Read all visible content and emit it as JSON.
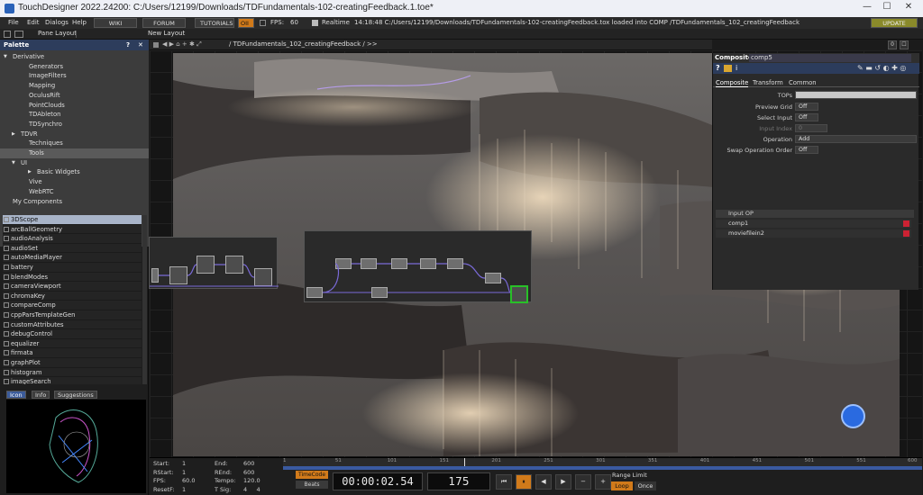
{
  "window": {
    "title": "TouchDesigner 2022.24200: C:/Users/12199/Downloads/TDFundamentals-102-creatingFeedback.1.toe*",
    "controls": [
      "—",
      "☐",
      "✕"
    ]
  },
  "menubar": {
    "items": [
      "File",
      "Edit",
      "Dialogs",
      "Help"
    ],
    "buttons": [
      "WIKI",
      "FORUM",
      "TUTORIALS"
    ],
    "oii": "OII",
    "fps_label": "FPS:",
    "fps_value": "60",
    "realtime": "Realtime",
    "status": "14:18:48 C:/Users/12199/Downloads/TDFundamentals-102-creatingFeedback.tox loaded into COMP /TDFundamentals_102_creatingFeedback",
    "update": "UPDATE"
  },
  "toolbar2": {
    "pane_layout": "Pane Layout",
    "new_layout": "New Layout"
  },
  "palette": {
    "title": "Palette",
    "header_buttons": [
      "?",
      "✕"
    ],
    "categories": [
      {
        "label": "Derivative",
        "indent": 0,
        "arrow": "▼"
      },
      {
        "label": "Generators",
        "indent": 2,
        "arrow": ""
      },
      {
        "label": "ImageFilters",
        "indent": 2,
        "arrow": ""
      },
      {
        "label": "Mapping",
        "indent": 2,
        "arrow": ""
      },
      {
        "label": "OculusRift",
        "indent": 2,
        "arrow": ""
      },
      {
        "label": "PointClouds",
        "indent": 2,
        "arrow": ""
      },
      {
        "label": "TDAbleton",
        "indent": 2,
        "arrow": ""
      },
      {
        "label": "TDSynchro",
        "indent": 2,
        "arrow": ""
      },
      {
        "label": "TDVR",
        "indent": 1,
        "arrow": "▶"
      },
      {
        "label": "Techniques",
        "indent": 2,
        "arrow": ""
      },
      {
        "label": "Tools",
        "indent": 2,
        "arrow": "",
        "selected": true
      },
      {
        "label": "UI",
        "indent": 1,
        "arrow": "▼"
      },
      {
        "label": "Basic Widgets",
        "indent": 3,
        "arrow": "▶"
      },
      {
        "label": "Vive",
        "indent": 2,
        "arrow": ""
      },
      {
        "label": "WebRTC",
        "indent": 2,
        "arrow": ""
      },
      {
        "label": "My Components",
        "indent": 0,
        "arrow": ""
      }
    ],
    "components": [
      "3DScope",
      "arcBallGeometry",
      "audioAnalysis",
      "audioSet",
      "autoMediaPlayer",
      "battery",
      "blendModes",
      "cameraViewport",
      "chromaKey",
      "compareComp",
      "cppParsTemplateGen",
      "customAttributes",
      "debugControl",
      "equalizer",
      "firmata",
      "graphPlot",
      "histogram",
      "imageSearch"
    ],
    "tabs": [
      "Icon",
      "Info",
      "Suggestions"
    ]
  },
  "network": {
    "path": "/ TDFundamentals_102_creatingFeedback / >>",
    "right_controls": [
      "0",
      "☐"
    ]
  },
  "params": {
    "op_type": "Composite",
    "op_name": "comp5",
    "tabs": [
      "Composite",
      "Transform",
      "Common"
    ],
    "rows": [
      {
        "label": "TOPs",
        "value": "",
        "type": "field"
      },
      {
        "label": "Preview Grid",
        "value": "Off",
        "type": "toggle"
      },
      {
        "label": "Select Input",
        "value": "Off",
        "type": "toggle"
      },
      {
        "label": "Input Index",
        "value": "0",
        "type": "slider",
        "disabled": true
      },
      {
        "label": "Operation",
        "value": "Add",
        "type": "menu"
      },
      {
        "label": "Swap Operation Order",
        "value": "Off",
        "type": "toggle"
      }
    ],
    "input_header": "Input OP",
    "inputs": [
      "comp1",
      "moviefilein2"
    ]
  },
  "timeline": {
    "ruler": [
      "1",
      "51",
      "101",
      "151",
      "201",
      "251",
      "301",
      "351",
      "401",
      "451",
      "501",
      "551",
      "600"
    ],
    "playhead_frame": 175,
    "range_frames": [
      1,
      600
    ],
    "info_left": [
      {
        "k": "Start:",
        "v": "1"
      },
      {
        "k": "RStart:",
        "v": "1"
      },
      {
        "k": "FPS:",
        "v": "60.0"
      },
      {
        "k": "ResetF:",
        "v": "1"
      }
    ],
    "info_right": [
      {
        "k": "End:",
        "v": "600"
      },
      {
        "k": "REnd:",
        "v": "600"
      },
      {
        "k": "Tempo:",
        "v": "120.0"
      },
      {
        "k": "T Sig:",
        "v": "4     4"
      }
    ],
    "timecode_btn": "TimeCode",
    "beats_btn": "Beats",
    "timecode": "00:00:02.54",
    "frame": "175",
    "transport": [
      "⏮",
      "⏸",
      "◀",
      "▶",
      "−",
      "+"
    ],
    "range_limit": "Range Limit",
    "loop": "Loop",
    "once": "Once"
  },
  "colors": {
    "accent": "#d17a1a",
    "selection": "#a8b4c8",
    "header": "#2d3d5c"
  }
}
